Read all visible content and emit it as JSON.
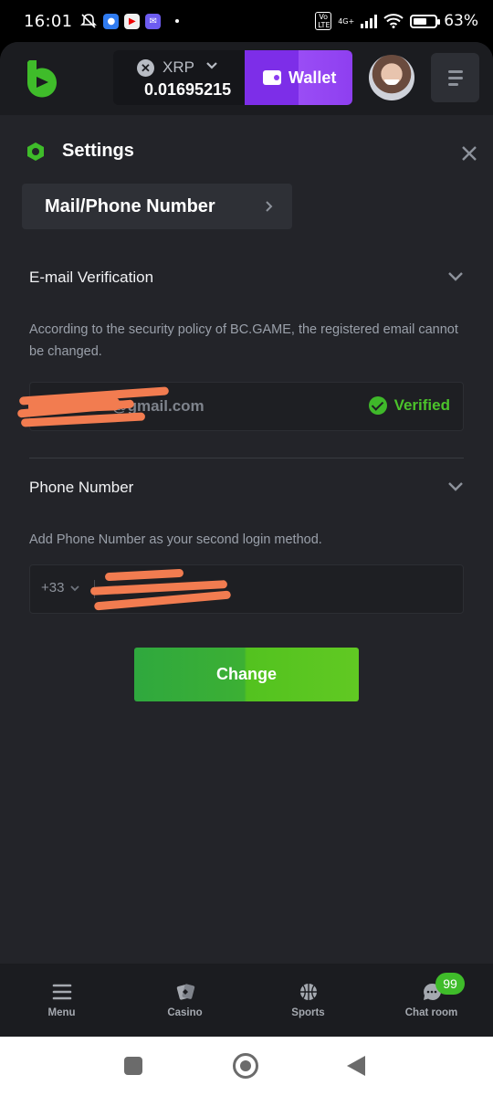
{
  "status_bar": {
    "time": "16:01",
    "battery": "63%",
    "network": "4G+",
    "volte": "Vo LTE",
    "battery_level": 0.63
  },
  "header": {
    "currency": {
      "name": "XRP",
      "balance": "0.01695215",
      "icon": "xrp-icon"
    },
    "wallet_label": "Wallet",
    "colors": {
      "brand_green": "#3fbc2a",
      "wallet_purple": "#7d2ee8",
      "background": "#232429"
    }
  },
  "settings": {
    "title": "Settings",
    "breadcrumb": "Mail/Phone Number",
    "email_section": {
      "title": "E-mail Verification",
      "description": "According to the security policy of BC.GAME, the registered email cannot be changed.",
      "value": "@gmail.com",
      "status": "Verified"
    },
    "phone_section": {
      "title": "Phone Number",
      "description": "Add Phone Number as your second login method.",
      "country_code": "+33"
    },
    "change_button": "Change"
  },
  "bottom_nav": {
    "items": [
      {
        "label": "Menu",
        "icon": "menu-icon"
      },
      {
        "label": "Casino",
        "icon": "casino-icon"
      },
      {
        "label": "Sports",
        "icon": "sports-icon"
      },
      {
        "label": "Chat room",
        "icon": "chat-icon"
      }
    ],
    "chat_badge": "99"
  }
}
